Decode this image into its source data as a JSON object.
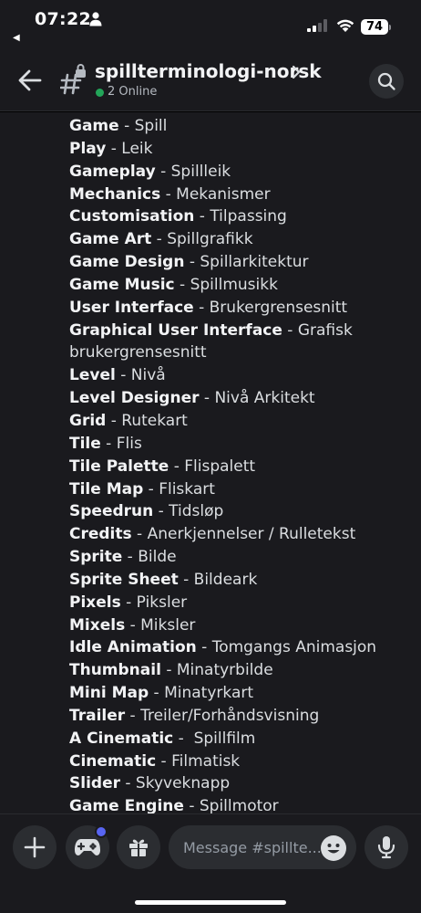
{
  "status_bar": {
    "time": "07:22",
    "back_label": "◀",
    "battery": "74"
  },
  "header": {
    "channel_name": "spillterminologi-norsk",
    "online": "2 Online"
  },
  "messages": [
    {
      "term": "Game",
      "translation": " - Spill"
    },
    {
      "term": "Play",
      "translation": " - Leik"
    },
    {
      "term": "Gameplay",
      "translation": " - Spillleik"
    },
    {
      "term": "Mechanics",
      "translation": " - Mekanismer"
    },
    {
      "term": "Customisation",
      "translation": " - Tilpassing"
    },
    {
      "term": "Game Art",
      "translation": " - Spillgrafikk"
    },
    {
      "term": "Game Design",
      "translation": " - Spillarkitektur"
    },
    {
      "term": "Game Music",
      "translation": " - Spillmusikk"
    },
    {
      "term": "User Interface",
      "translation": " - Brukergrensesnitt"
    },
    {
      "term": "Graphical User Interface",
      "translation": " - Grafisk brukergrensesnitt",
      "wrap": true
    },
    {
      "term": "Level",
      "translation": " - Nivå"
    },
    {
      "term": "Level Designer",
      "translation": " - Nivå Arkitekt"
    },
    {
      "term": "Grid",
      "translation": " - Rutekart"
    },
    {
      "term": "Tile",
      "translation": " - Flis"
    },
    {
      "term": "Tile Palette",
      "translation": " - Flispalett"
    },
    {
      "term": "Tile Map",
      "translation": " - Fliskart"
    },
    {
      "term": "Speedrun",
      "translation": " - Tidsløp"
    },
    {
      "term": "Credits",
      "translation": " - Anerkjennelser / Rulletekst"
    },
    {
      "term": "Sprite",
      "translation": " - Bilde"
    },
    {
      "term": "Sprite Sheet",
      "translation": " - Bildeark"
    },
    {
      "term": "Pixels",
      "translation": " - Piksler"
    },
    {
      "term": "Mixels",
      "translation": " - Miksler"
    },
    {
      "term": "Idle Animation",
      "translation": " - Tomgangs Animasjon"
    },
    {
      "term": "Thumbnail",
      "translation": " - Minatyrbilde"
    },
    {
      "term": "Mini Map",
      "translation": " - Minatyrkart"
    },
    {
      "term": "Trailer",
      "translation": " - Treiler/Forhåndsvisning"
    },
    {
      "term": "A Cinematic",
      "translation": " -  Spillfilm"
    },
    {
      "term": "Cinematic",
      "translation": " - Filmatisk"
    },
    {
      "term": "Slider",
      "translation": " - Skyveknapp"
    },
    {
      "term": "Game Engine",
      "translation": " - Spillmotor"
    }
  ],
  "composer": {
    "placeholder": "Message #spillte..."
  },
  "colors": {
    "background": "#1a1a1e",
    "online": "#23a559",
    "notification": "#5865f2",
    "button": "#2b2d31"
  }
}
